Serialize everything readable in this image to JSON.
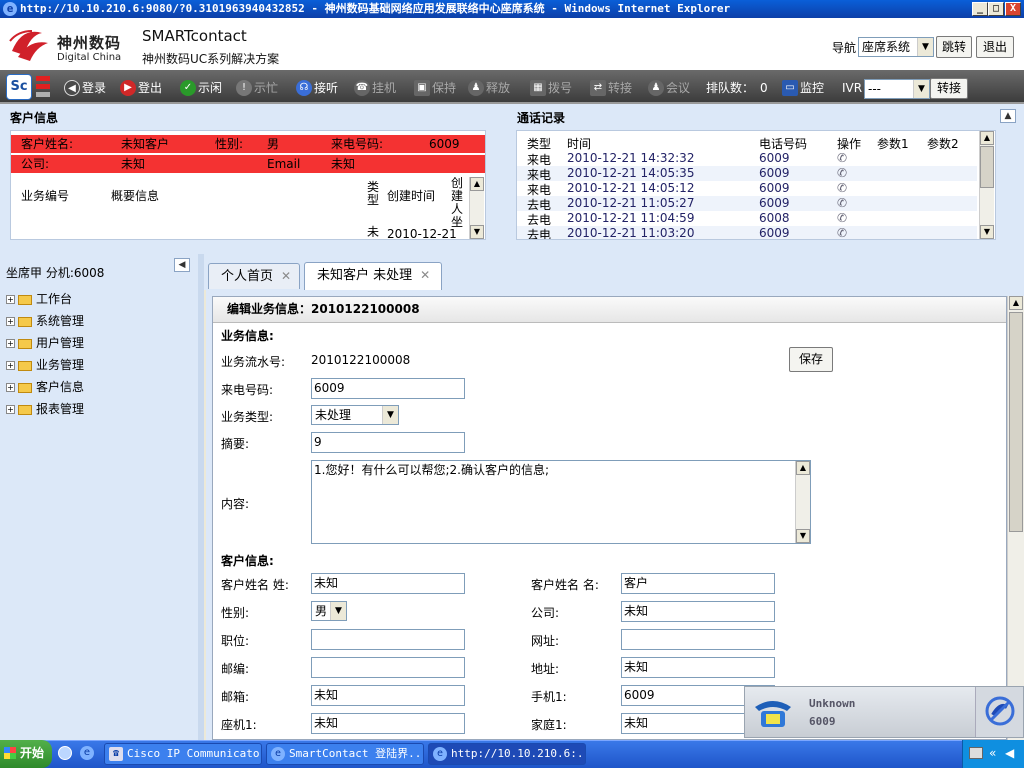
{
  "window": {
    "title": "http://10.10.210.6:9080/?0.3101963940432852 - 神州数码基础网络应用发展联络中心座席系统 - Windows Internet Explorer",
    "min": "_",
    "max": "□",
    "close": "X"
  },
  "header": {
    "brand_cn": "神州数码",
    "brand_en": "Digital China",
    "product": "SMARTcontact",
    "product_sub": "神州数码UC系列解决方案",
    "nav_label": "导航",
    "nav_value": "座席系统",
    "jump_button": "跳转",
    "logout_button": "退出"
  },
  "toolbar": {
    "login": "登录",
    "logout": "登出",
    "idle": "示闲",
    "busy": "示忙",
    "answer": "接听",
    "hangup": "挂机",
    "hold": "保持",
    "release": "释放",
    "dial": "拨号",
    "transfer": "转接",
    "meeting": "会议",
    "queue_label": "排队数：",
    "queue_value": "0",
    "monitor": "监控",
    "ivr_label": "IVR",
    "ivr_value": "---",
    "transfer_button": "转接"
  },
  "customer_info": {
    "title": "客户信息",
    "name_label": "客户姓名:",
    "name_value": "未知客户",
    "gender_label": "性别:",
    "gender_value": "男",
    "phone_label": "来电号码:",
    "phone_value": "6009",
    "company_label": "公司:",
    "company_value": "未知",
    "email_label": "Email",
    "email_value": "未知",
    "cols": [
      "业务编号",
      "概要信息",
      "类型",
      "创建时间",
      "创建人坐"
    ],
    "row": {
      "type": "未",
      "time": "2010-12-21"
    }
  },
  "call_log": {
    "title": "通话记录",
    "headers": [
      "类型",
      "时间",
      "电话号码",
      "操作",
      "参数1",
      "参数2"
    ],
    "rows": [
      {
        "type": "来电",
        "time": "2010-12-21 14:32:32",
        "phone": "6009"
      },
      {
        "type": "来电",
        "time": "2010-12-21 14:05:35",
        "phone": "6009"
      },
      {
        "type": "来电",
        "time": "2010-12-21 14:05:12",
        "phone": "6009"
      },
      {
        "type": "去电",
        "time": "2010-12-21 11:05:27",
        "phone": "6009"
      },
      {
        "type": "去电",
        "time": "2010-12-21 11:04:59",
        "phone": "6008"
      },
      {
        "type": "去电",
        "time": "2010-12-21 11:03:20",
        "phone": "6009"
      }
    ]
  },
  "agent": {
    "label": "坐席甲  分机:6008"
  },
  "tree": [
    "工作台",
    "系统管理",
    "用户管理",
    "业务管理",
    "客户信息",
    "报表管理"
  ],
  "tabs": [
    {
      "label": "个人首页"
    },
    {
      "label": "未知客户 未处理"
    }
  ],
  "form": {
    "heading": "编辑业务信息：2010122100008",
    "section_business": "业务信息:",
    "serial_label": "业务流水号:",
    "serial_value": "2010122100008",
    "save_button": "保存",
    "caller_label": "来电号码:",
    "caller_value": "6009",
    "type_label": "业务类型:",
    "type_value": "未处理",
    "summary_label": "摘要:",
    "summary_value": "9",
    "content_label": "内容:",
    "content_value": "1.您好！有什么可以帮您;2.确认客户的信息;",
    "section_customer": "客户信息:",
    "surname_label": "客户姓名 姓:",
    "surname_value": "未知",
    "givenname_label": "客户姓名 名:",
    "givenname_value": "客户",
    "gender_label": "性别:",
    "gender_value": "男",
    "company_label": "公司:",
    "company_value": "未知",
    "position_label": "职位:",
    "position_value": "",
    "website_label": "网址:",
    "website_value": "",
    "zip_label": "邮编:",
    "zip_value": "",
    "address_label": "地址:",
    "address_value": "未知",
    "email_label": "邮箱:",
    "email_value": "未知",
    "mobile_label": "手机1:",
    "mobile_value": "6009",
    "office_label": "座机1:",
    "office_value": "未知",
    "home_label": "家庭1:",
    "home_value": "未知"
  },
  "phone_popup": {
    "status": "Unknown",
    "number": "6009"
  },
  "taskbar": {
    "start": "开始",
    "items": [
      "Cisco IP Communicator",
      "SmartContact 登陆界...",
      "http://10.10.210.6:..."
    ]
  }
}
